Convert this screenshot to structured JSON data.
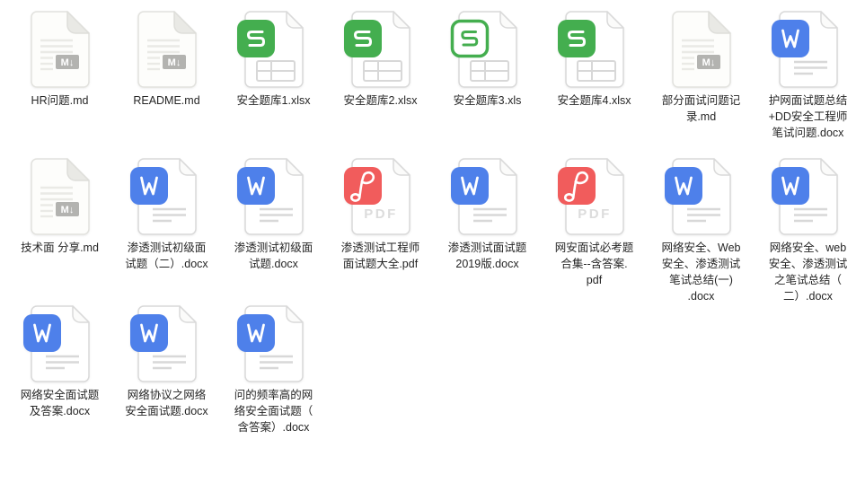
{
  "window": {
    "background": "#ffffff"
  },
  "colors": {
    "word_blue": "#4e80ea",
    "excel_green": "#44ae4f",
    "pdf_red": "#f15c5c",
    "md_badge_gray": "#b3b3b0",
    "page_border": "#d9d9d9",
    "label_text": "#262626"
  },
  "icons": {
    "md_badge_label": "M↓",
    "pdf_page_label": "PDF"
  },
  "files": [
    {
      "name": "HR问题.md",
      "type": "md"
    },
    {
      "name": "README.md",
      "type": "md"
    },
    {
      "name": "安全题库1.xlsx",
      "type": "xlsx"
    },
    {
      "name": "安全题库2.xlsx",
      "type": "xlsx"
    },
    {
      "name": "安全题库3.xls",
      "type": "xls"
    },
    {
      "name": "安全题库4.xlsx",
      "type": "xlsx"
    },
    {
      "name": "部分面试问题记\n录.md",
      "type": "md"
    },
    {
      "name": "护网面试题总结\n+DD安全工程师\n笔试问题.docx",
      "type": "docx"
    },
    {
      "name": "技术面 分享.md",
      "type": "md"
    },
    {
      "name": "渗透测试初级面\n试题（二）.docx",
      "type": "docx"
    },
    {
      "name": "渗透测试初级面\n试题.docx",
      "type": "docx"
    },
    {
      "name": "渗透测试工程师\n面试题大全.pdf",
      "type": "pdf"
    },
    {
      "name": "渗透测试面试题\n2019版.docx",
      "type": "docx"
    },
    {
      "name": "网安面试必考题\n合集--含答案.\npdf",
      "type": "pdf"
    },
    {
      "name": "网络安全、Web\n安全、渗透测试\n笔试总结(一)\n.docx",
      "type": "docx"
    },
    {
      "name": "网络安全、web\n安全、渗透测试\n之笔试总结（\n二）.docx",
      "type": "docx"
    },
    {
      "name": "网络安全面试题\n及答案.docx",
      "type": "docx"
    },
    {
      "name": "网络协议之网络\n安全面试题.docx",
      "type": "docx"
    },
    {
      "name": "问的频率高的网\n络安全面试题（\n含答案）.docx",
      "type": "docx"
    }
  ]
}
